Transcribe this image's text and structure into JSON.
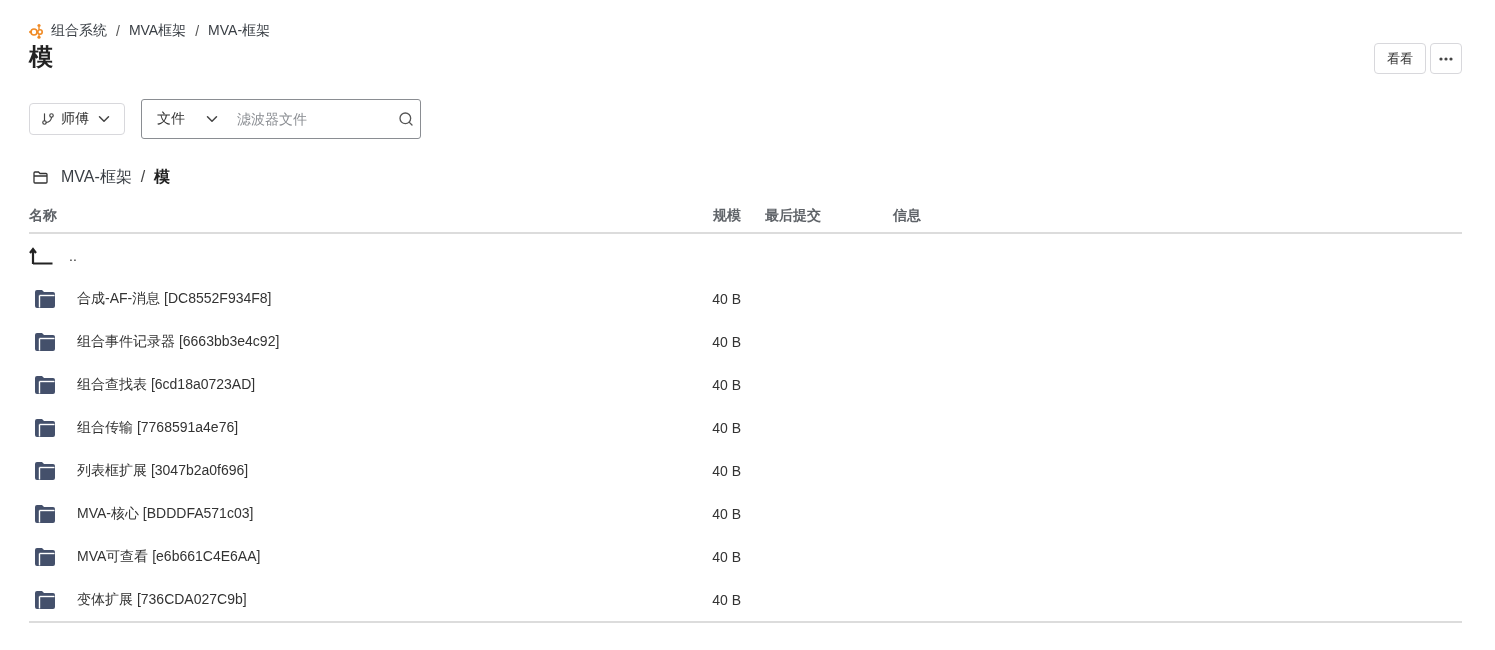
{
  "breadcrumb": [
    {
      "label": "组合系统"
    },
    {
      "separator": "/",
      "label": "MVA框架"
    },
    {
      "separator": "/",
      "label": "MVA-框架"
    }
  ],
  "title": "模",
  "actions": [
    {
      "kind": "text",
      "label": "看看"
    },
    {
      "kind": "more"
    }
  ],
  "toolbar": {
    "branch": "师傅",
    "search": {
      "scope": "文件",
      "placeholder": "滤波器文件"
    }
  },
  "path": [
    {
      "label": "MVA-框架",
      "current": false
    },
    {
      "separator": "/",
      "label": "模",
      "current": true
    }
  ],
  "table": {
    "columns": [
      "名称",
      "规模",
      "最后提交",
      "信息"
    ],
    "rows": [
      {
        "kind": "parent",
        "name": ".."
      },
      {
        "kind": "folder",
        "name": "合成-AF-消息 [DC8552F934F8]",
        "size": "40 B"
      },
      {
        "kind": "folder",
        "name": "组合事件记录器 [6663bb3e4c92]",
        "size": "40 B"
      },
      {
        "kind": "folder",
        "name": "组合查找表 [6cd18a0723AD]",
        "size": "40 B"
      },
      {
        "kind": "folder",
        "name": "组合传输 [7768591a4e76]",
        "size": "40 B"
      },
      {
        "kind": "folder",
        "name": "列表框扩展 [3047b2a0f696]",
        "size": "40 B"
      },
      {
        "kind": "folder",
        "name": "MVA-核心 [BDDDFA571c03]",
        "size": "40 B"
      },
      {
        "kind": "folder",
        "name": "MVA可查看 [e6b661C4E6AA]",
        "size": "40 B"
      },
      {
        "kind": "folder",
        "name": "变体扩展 [736CDA027C9b]",
        "size": "40 B"
      }
    ]
  }
}
